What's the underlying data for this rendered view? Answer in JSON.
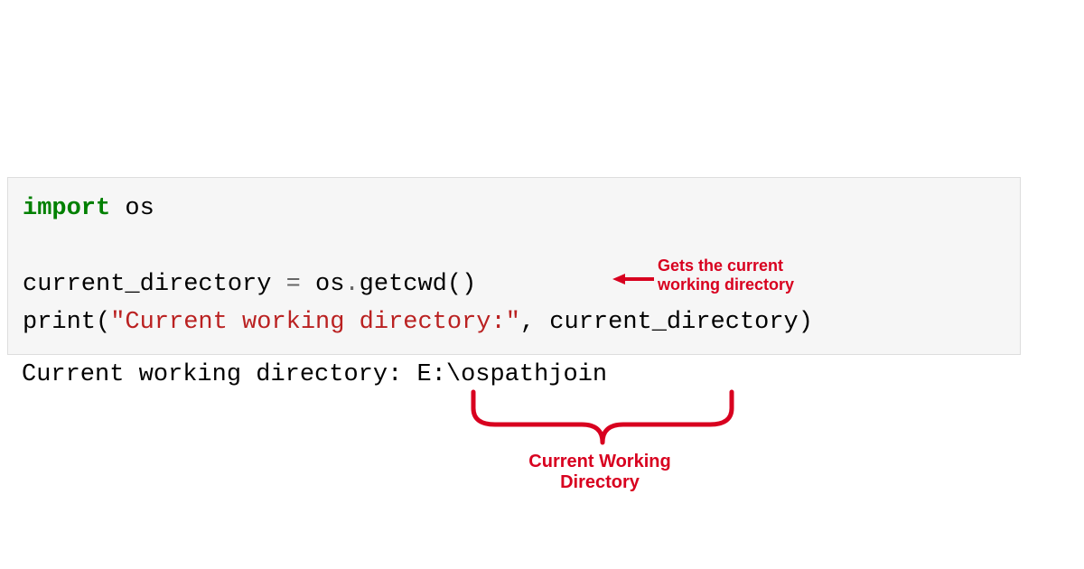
{
  "code": {
    "line1": {
      "import_kw": "import",
      "module": " os"
    },
    "line2": {
      "var": "current_directory ",
      "eq": "=",
      "rhs": " os",
      "dot": ".",
      "call": "getcwd()"
    },
    "line3": {
      "print": "print",
      "open": "(",
      "string": "\"Current working directory:\"",
      "comma": ",",
      "arg": " current_directory",
      "close": ")"
    }
  },
  "output": {
    "text": "Current working directory: E:\\ospathjoin"
  },
  "annotations": {
    "getcwd_note_l1": "Gets the current",
    "getcwd_note_l2": "working directory",
    "cwd_label_l1": "Current Working",
    "cwd_label_l2": "Directory"
  },
  "colors": {
    "anno_red": "#D8001F"
  }
}
